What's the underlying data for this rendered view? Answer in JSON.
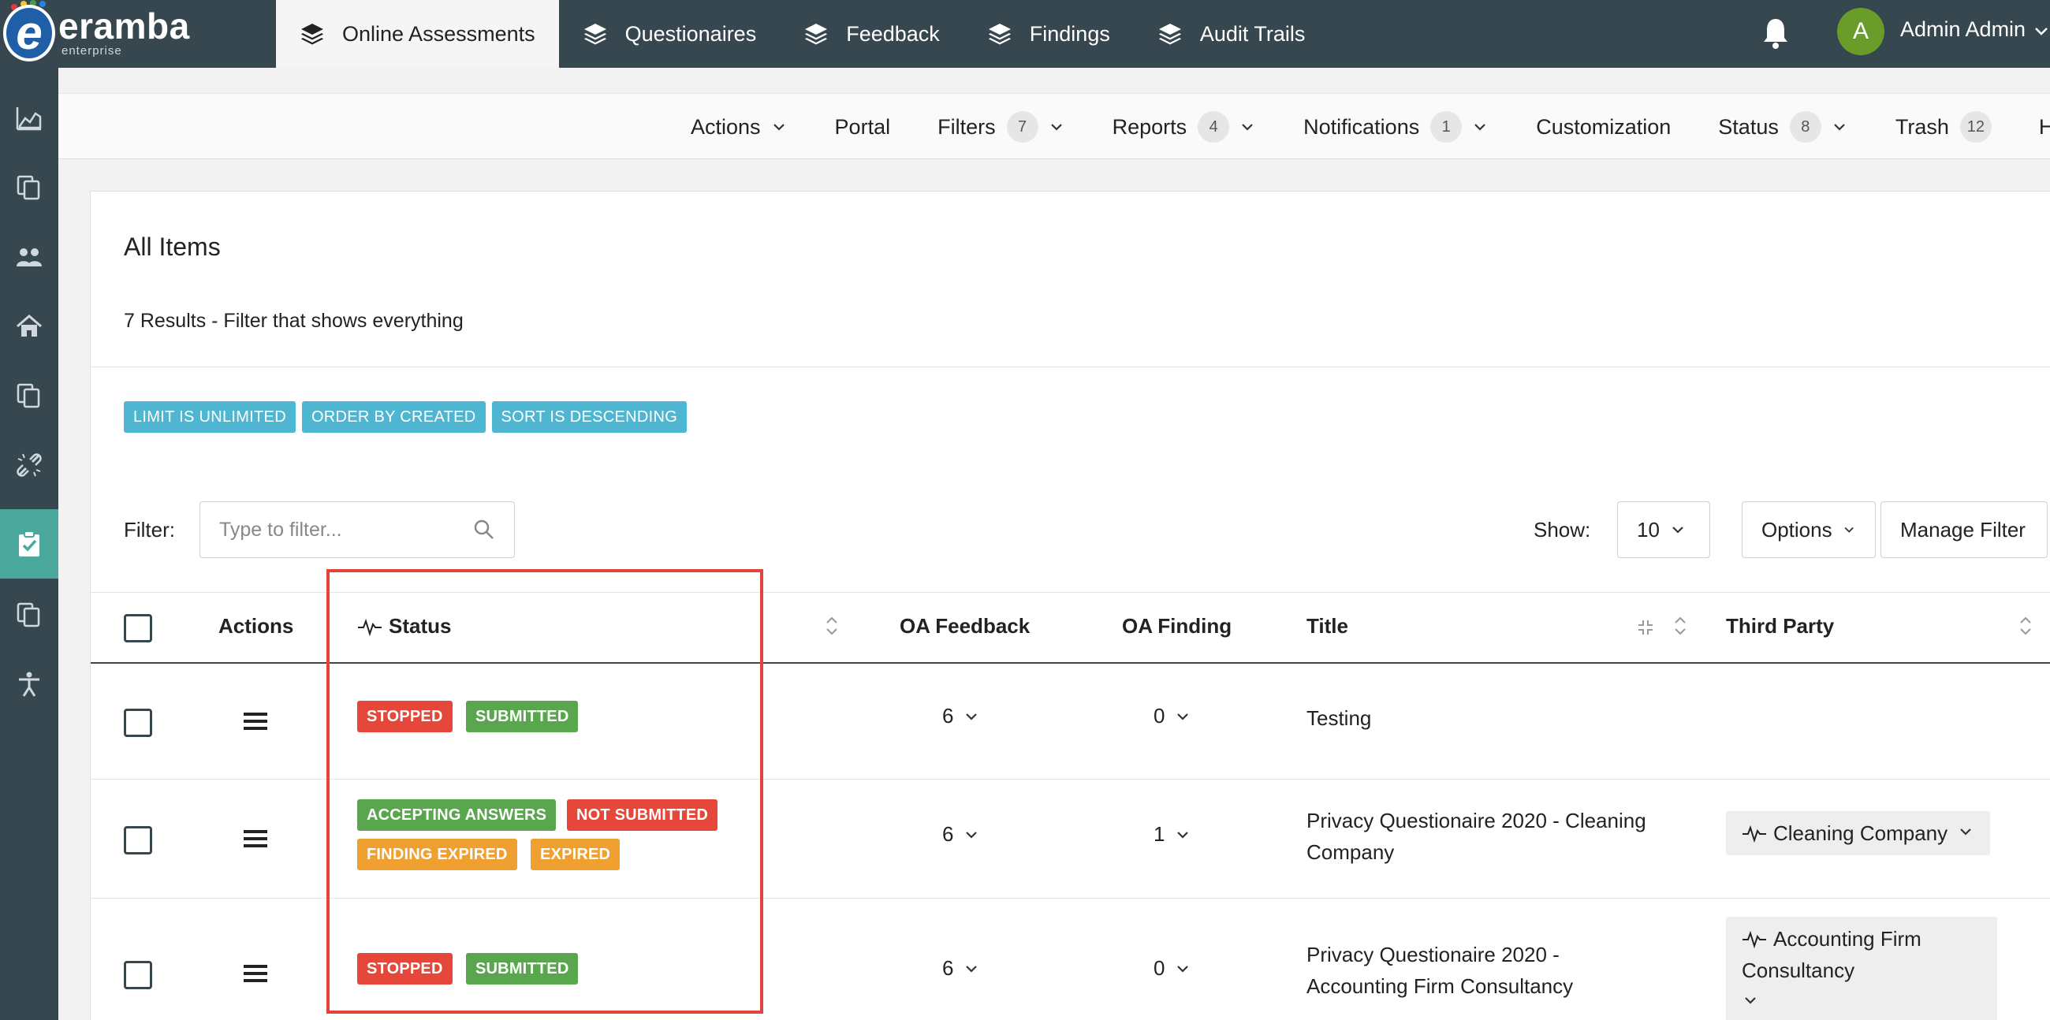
{
  "app": {
    "brand": "eramba",
    "edition": "enterprise"
  },
  "topnav": [
    {
      "label": "Online Assessments",
      "active": true
    },
    {
      "label": "Questionaires",
      "active": false
    },
    {
      "label": "Feedback",
      "active": false
    },
    {
      "label": "Findings",
      "active": false
    },
    {
      "label": "Audit Trails",
      "active": false
    }
  ],
  "user": {
    "initial": "A",
    "name": "Admin Admin"
  },
  "sidebar": {
    "items": [
      {
        "icon": "chart-icon"
      },
      {
        "icon": "documents-icon"
      },
      {
        "icon": "users-icon"
      },
      {
        "icon": "home-icon"
      },
      {
        "icon": "documents-icon"
      },
      {
        "icon": "broken-link-icon"
      },
      {
        "icon": "clipboard-check-icon",
        "active": true
      },
      {
        "icon": "documents-icon"
      },
      {
        "icon": "accessibility-icon"
      }
    ]
  },
  "subnav": {
    "actions": "Actions",
    "portal": "Portal",
    "filters": {
      "label": "Filters",
      "count": "7"
    },
    "reports": {
      "label": "Reports",
      "count": "4"
    },
    "notifications": {
      "label": "Notifications",
      "count": "1"
    },
    "customization": "Customization",
    "status": {
      "label": "Status",
      "count": "8"
    },
    "trash": {
      "label": "Trash",
      "count": "12"
    },
    "help": "Help"
  },
  "panel": {
    "title": "All Items",
    "subtitle": "7 Results - Filter that shows everything",
    "chips": [
      "LIMIT IS UNLIMITED",
      "ORDER BY CREATED",
      "SORT IS DESCENDING"
    ],
    "filter_label": "Filter:",
    "filter_placeholder": "Type to filter...",
    "show_label": "Show:",
    "show_value": "10",
    "options_label": "Options",
    "manage_filter_label": "Manage Filter"
  },
  "table": {
    "columns": {
      "actions": "Actions",
      "status": "Status",
      "oa_feedback": "OA Feedback",
      "oa_finding": "OA Finding",
      "title": "Title",
      "third_party": "Third Party"
    },
    "rows": [
      {
        "badges": [
          {
            "text": "STOPPED",
            "color": "#e5483a"
          },
          {
            "text": "SUBMITTED",
            "color": "#5aa64e"
          }
        ],
        "feedback": "6",
        "finding": "0",
        "title_lines": [
          "Testing"
        ],
        "third_party_lines": []
      },
      {
        "badges": [
          {
            "text": "ACCEPTING ANSWERS",
            "color": "#5aa64e"
          },
          {
            "text": "NOT SUBMITTED",
            "color": "#e5483a"
          },
          {
            "text": "FINDING EXPIRED",
            "color": "#f0a030"
          },
          {
            "text": "EXPIRED",
            "color": "#f0a030"
          }
        ],
        "feedback": "6",
        "finding": "1",
        "title_lines": [
          "Privacy Questionaire 2020 - Cleaning",
          "Company"
        ],
        "third_party_lines": [
          "Cleaning Company"
        ]
      },
      {
        "badges": [
          {
            "text": "STOPPED",
            "color": "#e5483a"
          },
          {
            "text": "SUBMITTED",
            "color": "#5aa64e"
          }
        ],
        "feedback": "6",
        "finding": "0",
        "title_lines": [
          "Privacy Questionaire 2020 -",
          "Accounting Firm Consultancy"
        ],
        "third_party_lines": [
          "Accounting Firm",
          "Consultancy"
        ]
      }
    ]
  },
  "colors": {
    "topbar": "#37474f",
    "accent": "#4aa89c",
    "chip": "#4fb6d2",
    "highlight": "#e3433a"
  }
}
